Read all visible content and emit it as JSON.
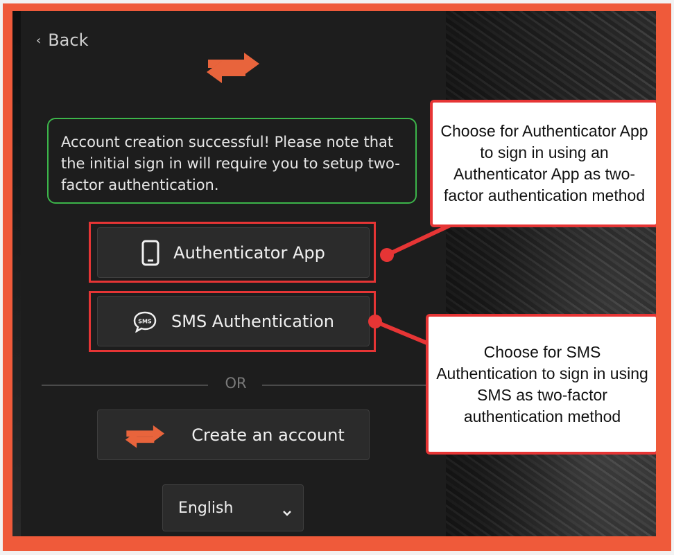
{
  "back_label": "Back",
  "notice": {
    "text": "Account creation successful! Please note that the initial sign in will require you to setup two-factor authentication."
  },
  "buttons": {
    "authenticator_app": "Authenticator App",
    "sms_authentication": "SMS Authentication",
    "create_account": "Create an account"
  },
  "divider_text": "OR",
  "language": {
    "selected": "English"
  },
  "callouts": {
    "authenticator": "Choose for Authenticator App to sign in using an Authenticator App as two-factor authentication method",
    "sms": "Choose for SMS Authentication to sign in using SMS as two-factor authentication method"
  },
  "colors": {
    "frame": "#ef5a3a",
    "accent": "#e8643c",
    "highlight": "#e63535",
    "success_border": "#3cb54a",
    "panel": "#1d1d1d"
  },
  "icons": {
    "back": "chevron-left-icon",
    "logo": "swap-arrows-logo",
    "authenticator": "smartphone-icon",
    "sms": "sms-bubble-icon",
    "caret": "chevron-down-icon"
  }
}
